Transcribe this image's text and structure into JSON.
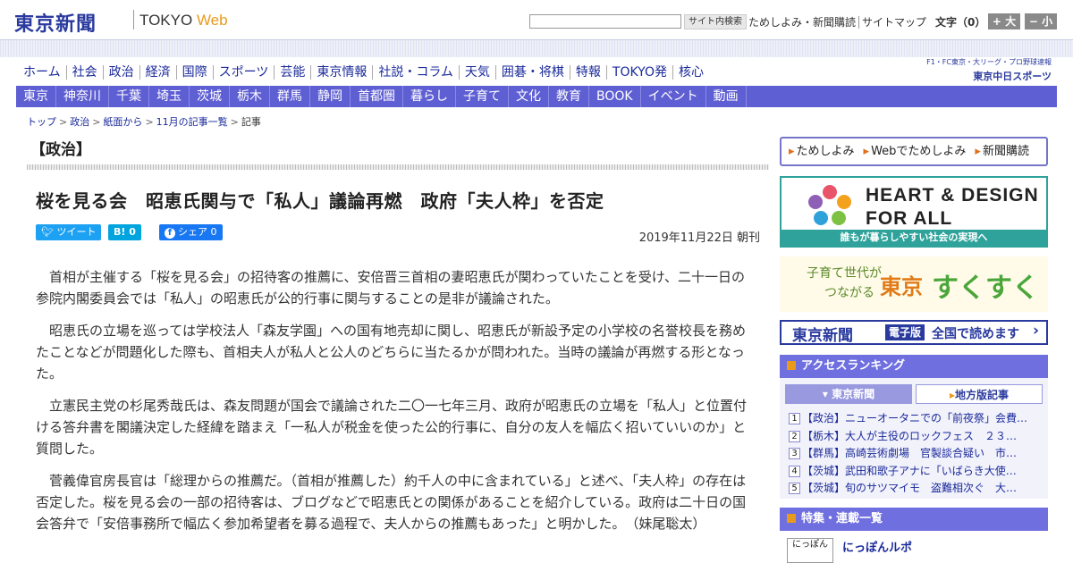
{
  "header": {
    "logo": "東京新聞",
    "logo_sub_a": "TOKYO ",
    "logo_sub_b": "Web",
    "search_placeholder": "",
    "search_button": "サイト内検索",
    "top_links": [
      "ためしよみ・新聞購読",
      "サイトマップ"
    ],
    "font_size_label": "文字（0）",
    "font_larger": "+ 大",
    "font_smaller": "− 小"
  },
  "main_nav": [
    "ホーム",
    "社会",
    "政治",
    "経済",
    "国際",
    "スポーツ",
    "芸能",
    "東京情報",
    "社説・コラム",
    "天気",
    "囲碁・将棋",
    "特報",
    "TOKYO発",
    "核心"
  ],
  "sports_banner": {
    "line1": "F1・FC東京・大リーグ・プロ野球速報",
    "line2": "東京中日スポーツ"
  },
  "sub_nav": [
    "東京",
    "神奈川",
    "千葉",
    "埼玉",
    "茨城",
    "栃木",
    "群馬",
    "静岡",
    "首都圏",
    "暮らし",
    "子育て",
    "文化",
    "教育",
    "BOOK",
    "イベント",
    "動画"
  ],
  "breadcrumb": [
    "トップ",
    "政治",
    "紙面から",
    "11月の記事一覧",
    "記事"
  ],
  "section_title": "【政治】",
  "article": {
    "title": "桜を見る会　昭恵氏関与で「私人」議論再燃　政府「夫人枠」を否定",
    "date": "2019年11月22日 朝刊",
    "paragraphs": [
      "首相が主催する「桜を見る会」の招待客の推薦に、安倍晋三首相の妻昭恵氏が関わっていたことを受け、二十一日の参院内閣委員会では「私人」の昭恵氏が公的行事に関与することの是非が議論された。",
      "昭恵氏の立場を巡っては学校法人「森友学園」への国有地売却に関し、昭恵氏が新設予定の小学校の名誉校長を務めたことなどが問題化した際も、首相夫人が私人と公人のどちらに当たるかが問われた。当時の議論が再燃する形となった。",
      "立憲民主党の杉尾秀哉氏は、森友問題が国会で議論された二〇一七年三月、政府が昭恵氏の立場を「私人」と位置付ける答弁書を閣議決定した経緯を踏まえ「一私人が税金を使った公的行事に、自分の友人を幅広く招いていいのか」と質問した。",
      "菅義偉官房長官は「総理からの推薦だ。（首相が推薦した）約千人の中に含まれている」と述べ、「夫人枠」の存在は否定した。桜を見る会の一部の招待客は、ブログなどで昭恵氏との関係があることを紹介している。政府は二十日の国会答弁で「安倍事務所で幅広く参加希望者を募る過程で、夫人からの推薦もあった」と明かした。　（妹尾聡太）"
    ]
  },
  "share": {
    "tweet": "ツイート",
    "hatena": "B! 0",
    "facebook": "シェア 0"
  },
  "sidebar": {
    "trial_links": [
      "ためしよみ",
      "Webでためしよみ",
      "新聞購読"
    ],
    "heart_title1": "HEART & DESIGN",
    "heart_title2": "FOR ALL",
    "heart_caption": "誰もが暮らしやすい社会の実現へ",
    "suku_a": "子育て世代が",
    "suku_b": "つながる",
    "suku_c": "東京",
    "suku_d": "すくすく",
    "denshi_name": "東京新聞",
    "denshi_tag": "電子版",
    "denshi_text": "全国で読めます",
    "ranking_title": "アクセスランキング",
    "ranking_tabs": [
      "東京新聞",
      "地方版記事"
    ],
    "ranking": [
      {
        "num": "1",
        "text": "【政治】ニューオータニでの「前夜祭」会費…"
      },
      {
        "num": "2",
        "text": "【栃木】大人が主役のロックフェス　２３…"
      },
      {
        "num": "3",
        "text": "【群馬】高崎芸術劇場　官製談合疑い　市…"
      },
      {
        "num": "4",
        "text": "【茨城】武田和歌子アナに「いばらき大使…"
      },
      {
        "num": "5",
        "text": "【茨城】旬のサツマイモ　盗難相次ぐ　大…"
      }
    ],
    "tokushu_title": "特集・連載一覧",
    "tokushu_thumb": "にっぽん",
    "tokushu_label": "にっぽんルポ"
  },
  "colors": {
    "brand": "#2a3a9e",
    "subnav": "#5f5fd4",
    "twitter": "#1da1f2",
    "hatena": "#00a4de",
    "facebook": "#1877f2",
    "accent": "#e89a1c"
  }
}
